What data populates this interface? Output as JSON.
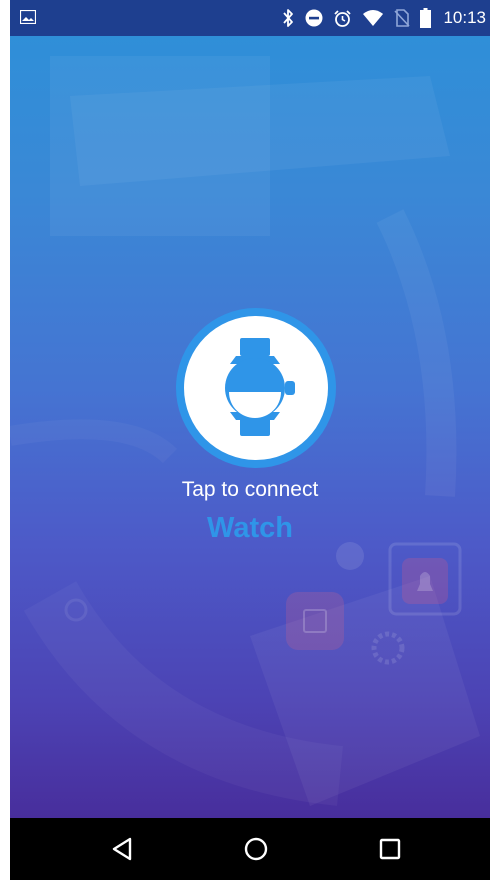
{
  "status_bar": {
    "time": "10:13",
    "icons": [
      "image-icon",
      "bluetooth-icon",
      "do-not-disturb-icon",
      "alarm-icon",
      "wifi-icon",
      "no-sim-icon",
      "battery-icon"
    ]
  },
  "main": {
    "connect_button_icon": "watch-icon",
    "tap_text": "Tap to connect",
    "device_text": "Watch"
  },
  "navigation_bar": {
    "buttons": [
      "back-icon",
      "home-icon",
      "recents-icon"
    ]
  },
  "colors": {
    "accent": "#2f95e8",
    "status_bar": "#1e3f8f",
    "gradient_top": "#2f8fd8",
    "gradient_bottom": "#482e9c",
    "nav_bar": "#000000"
  }
}
